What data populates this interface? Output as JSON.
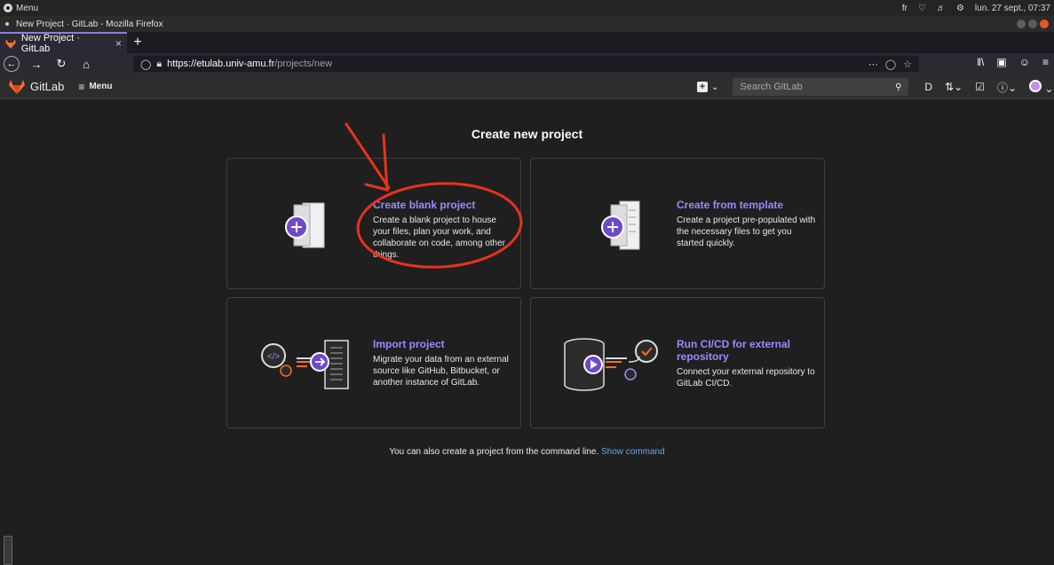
{
  "os": {
    "menu_label": "Menu",
    "keyboard": "fr",
    "datetime": "lun. 27 sept., 07:37"
  },
  "window": {
    "title": "New Project · GitLab - Mozilla Firefox"
  },
  "browser": {
    "tab_title": "New Project · GitLab",
    "url_host": "https://etulab.univ-amu.fr",
    "url_path": "/projects/new"
  },
  "gitlab": {
    "brand": "GitLab",
    "menu_label": "Menu",
    "search_placeholder": "Search GitLab"
  },
  "page": {
    "title": "Create new project",
    "cards": [
      {
        "title": "Create blank project",
        "desc": "Create a blank project to house your files, plan your work, and collaborate on code, among other things."
      },
      {
        "title": "Create from template",
        "desc": "Create a project pre-populated with the necessary files to get you started quickly."
      },
      {
        "title": "Import project",
        "desc": "Migrate your data from an external source like GitHub, Bitbucket, or another instance of GitLab."
      },
      {
        "title": "Run CI/CD for external repository",
        "desc": "Connect your external repository to GitLab CI/CD."
      }
    ],
    "cmdline_text": "You can also create a project from the command line.",
    "cmdline_link": "Show command"
  },
  "colors": {
    "accent_purple": "#9b8aff",
    "link_blue": "#63a6e9",
    "annotation_red": "#e8321e",
    "gitlab_orange": "#fc6d26"
  }
}
